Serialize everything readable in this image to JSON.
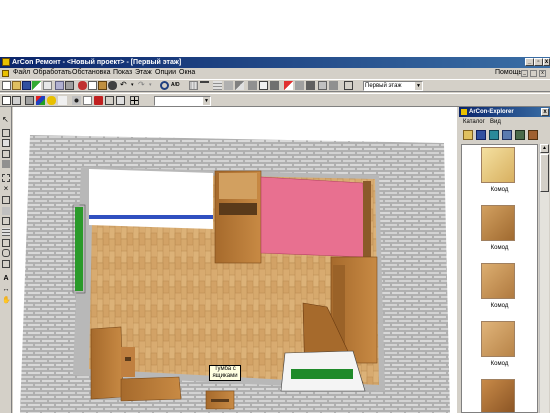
{
  "app": {
    "title": "ArCon Ремонт - <Новый проект> - [Первый этаж]",
    "window_buttons": {
      "minimize": "_",
      "restore": "▫",
      "close": "x"
    }
  },
  "menu": {
    "items": [
      "Файл",
      "Обработать",
      "Обстановка",
      "Показ",
      "Этаж",
      "Опции",
      "Окна"
    ],
    "help": "Помощь"
  },
  "toolbar": {
    "floor_select": "Первый этаж",
    "zoom_label": "A/D"
  },
  "explorer": {
    "title": "ArCon-Explorer",
    "menu": [
      "Каталог",
      "Вид"
    ],
    "items": [
      {
        "label": "Комод"
      },
      {
        "label": "Комод"
      },
      {
        "label": "Комод"
      },
      {
        "label": "Комод"
      },
      {
        "label": ""
      }
    ]
  },
  "viewport": {
    "tooltip_line1": "Тумба с",
    "tooltip_line2": "ящиками"
  },
  "colors": {
    "title_gradient_start": "#0a246a",
    "title_gradient_end": "#3a6ea5",
    "wall": "#c8c8c8",
    "floor": "#d6a86a",
    "bed": "#e87090"
  }
}
